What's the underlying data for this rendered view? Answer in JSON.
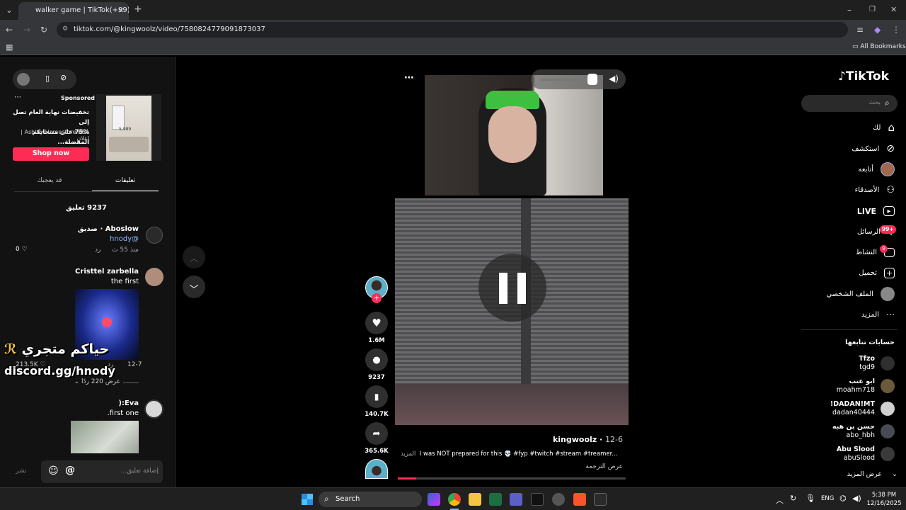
{
  "browser": {
    "tab_title": "walker game | TikTok(+99)",
    "url": "tiktok.com/@kingwoolz/video/7580824779091873037",
    "bookmarks_label": "All Bookmarks"
  },
  "left_panel": {
    "ad": {
      "sponsored": "Sponsored",
      "line1": "تخفيضات نهاية العام تصل إلى",
      "line2": "75% على منتجاتكم المفضلة...",
      "advertiser": "Ashley Homestore KSA | إعلان",
      "cta": "Shop now",
      "price_tag": "5,989"
    },
    "tabs": [
      "تعليقات",
      "قد يعجبك"
    ],
    "comment_count": "9237 تعليق",
    "comments": [
      {
        "name": "Aboslow · صديق",
        "text": "@hnody",
        "time": "منذ 55 ث",
        "reply": "رد",
        "likes": "0"
      },
      {
        "name": "Cristtel zarbella",
        "text": "the first",
        "time": "12-7",
        "reply": "رد",
        "likes": "213.5K",
        "view_replies": "عرض 220 ردًا"
      },
      {
        "name": "Eva:(",
        "text": "first one."
      }
    ],
    "overlay_line1": "حياكم متجري",
    "overlay_line2": "discord.gg/hnody",
    "comment_input_placeholder": "إضافة تعليق...",
    "post_label": "نشر"
  },
  "video": {
    "author": "kingwoolz",
    "date": "12-6",
    "caption": "I was NOT prepared for this 💀 #fyp #twitch #stream #treamer...",
    "more": "المزيد",
    "translate": "عرض الترجمة",
    "likes": "1.6M",
    "comments": "9237",
    "saves": "140.7K",
    "shares": "365.6K"
  },
  "right_nav": {
    "logo": "TikTok",
    "search_placeholder": "بحث",
    "items": [
      "لك",
      "استكشف",
      "أتابعه",
      "الأصدقاء",
      "LIVE",
      "الرسائل",
      "النشاط",
      "تحميل",
      "الملف الشخصي",
      "المزيد"
    ],
    "messages_badge": "99+",
    "activity_badge": "9",
    "following_header": "حسابات تتابعها",
    "following": [
      {
        "name": "Tfzo",
        "handle": "tgd9"
      },
      {
        "name": "ابو عتب",
        "handle": "moahm718"
      },
      {
        "name": "!DADAN!MT",
        "handle": "dadan40444"
      },
      {
        "name": "حسن بن هبه",
        "handle": "abo_hbh"
      },
      {
        "name": "Abu Slood",
        "handle": "abuSlood"
      }
    ],
    "see_more": "عرض المزيد"
  },
  "taskbar": {
    "search_label": "Search",
    "lang": "ENG",
    "time": "5:38 PM",
    "date": "12/16/2025"
  }
}
